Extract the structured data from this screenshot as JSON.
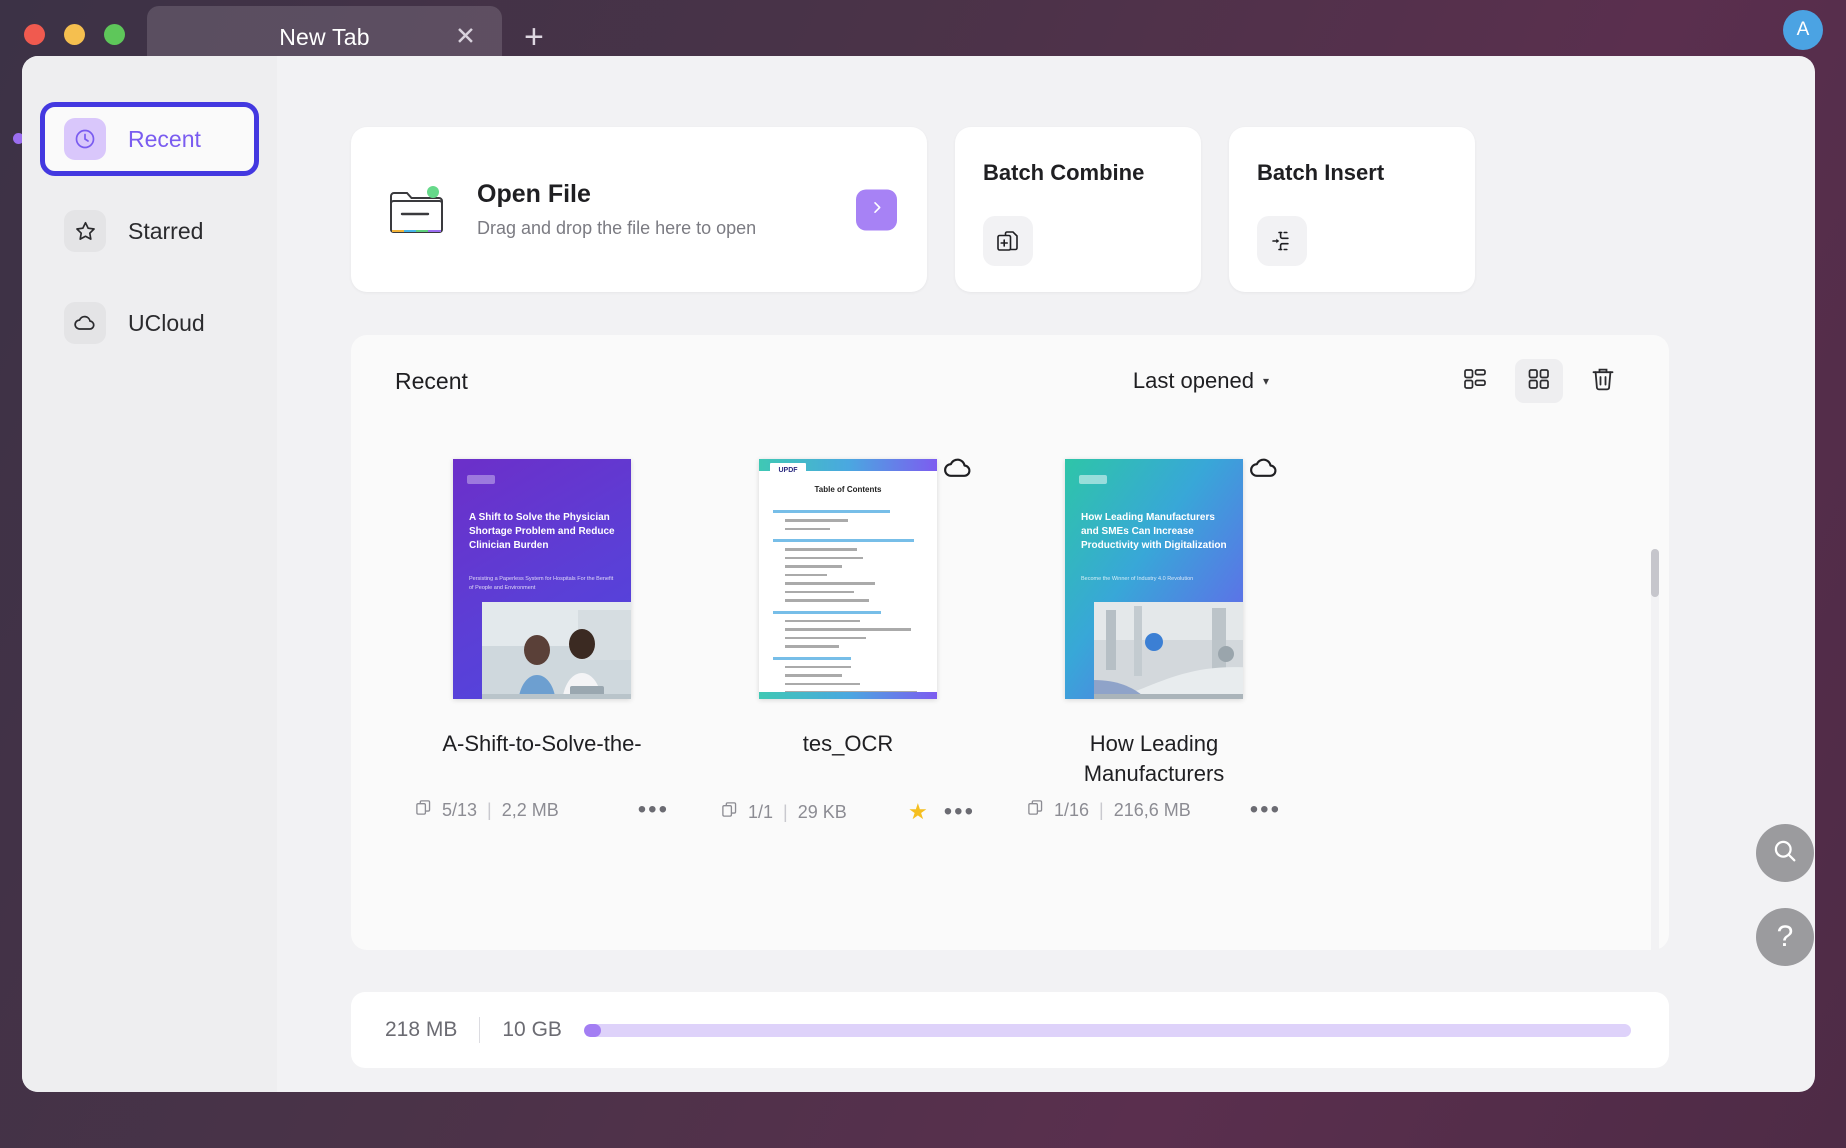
{
  "window": {
    "tab_title": "New Tab",
    "close_icon": "close-icon",
    "new_tab_icon": "plus-icon",
    "avatar_initial": "A"
  },
  "sidebar": {
    "items": [
      {
        "label": "Recent",
        "icon": "clock-icon",
        "active": true
      },
      {
        "label": "Starred",
        "icon": "star-icon",
        "active": false
      },
      {
        "label": "UCloud",
        "icon": "cloud-icon",
        "active": false
      }
    ]
  },
  "open_file": {
    "title": "Open File",
    "subtitle": "Drag and drop the file here to open",
    "icon": "folder-icon",
    "arrow_icon": "chevron-right-icon"
  },
  "quick_actions": [
    {
      "title": "Batch Combine",
      "icon": "combine-pages-icon"
    },
    {
      "title": "Batch Insert",
      "icon": "insert-pages-icon"
    }
  ],
  "recent": {
    "title": "Recent",
    "sort": {
      "label": "Last opened",
      "caret": "▾"
    },
    "views": [
      {
        "name": "list-view",
        "icon": "list-view-icon",
        "selected": false
      },
      {
        "name": "grid-view",
        "icon": "grid-view-icon",
        "selected": true
      }
    ],
    "delete_icon": "trash-icon",
    "files": [
      {
        "name": "A-Shift-to-Solve-the-",
        "pages": "5/13",
        "size": "2,2 MB",
        "starred": false,
        "cloud": false,
        "cover_title": "A Shift to Solve the Physician Shortage Problem and Reduce Clinician Burden",
        "cover_sub": "Persisting a Paperless System for Hospitals For the Benefit of People and Environment"
      },
      {
        "name": "tes_OCR",
        "pages": "1/1",
        "size": "29 KB",
        "starred": true,
        "cloud": true,
        "cover_title": "Table of Contents",
        "cover_sub": "UPDF"
      },
      {
        "name": "How Leading Manufacturers",
        "pages": "1/16",
        "size": "216,6 MB",
        "starred": false,
        "cloud": true,
        "cover_title": "How Leading Manufacturers and SMEs Can Increase Productivity with Digitalization",
        "cover_sub": "Become the Winner of Industry 4.0 Revolution"
      }
    ]
  },
  "storage": {
    "used": "218 MB",
    "total": "10 GB",
    "divider": "|",
    "percent": 2
  },
  "fabs": [
    {
      "name": "search-fab",
      "icon": "search-icon"
    },
    {
      "name": "help-fab",
      "icon": "question-mark-icon",
      "glyph": "?"
    }
  ],
  "colors": {
    "accent": "#7a5cf0",
    "focus_ring": "#4338e0",
    "star": "#f5bf20",
    "avatar": "#4ba3e3"
  }
}
